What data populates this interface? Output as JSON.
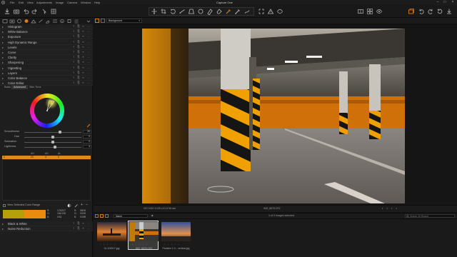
{
  "window": {
    "title": "Capture One",
    "menu": [
      "File",
      "Edit",
      "View",
      "Adjustments",
      "Image",
      "Camera",
      "Window",
      "Help"
    ],
    "controls": [
      "–",
      "□",
      "×"
    ]
  },
  "toolbar": {
    "left_icons": [
      "import-icon",
      "camera-icon",
      "undo-icon",
      "redo-icon",
      "cursor-icon",
      "grid-icon"
    ],
    "center_icons": [
      "pan-icon",
      "crop-icon",
      "rotate-icon",
      "straighten-icon",
      "keystone-icon",
      "spot-icon",
      "mask-icon",
      "erase-icon",
      "eyedropper-icon",
      "color-picker-icon",
      "annotate-icon"
    ],
    "right_icons": [
      "focus-icon",
      "exposure-warning-icon",
      "proof-icon",
      "compare-icon",
      "grid-view-icon",
      "eye-icon"
    ],
    "far_right_icons": [
      "workspace-icon",
      "rotate-left-icon",
      "rotate-right-icon",
      "reset-icon",
      "copy-icon",
      "paste-icon"
    ]
  },
  "tools": {
    "headers": [
      "Histogram",
      "White Balance",
      "Exposure",
      "High Dynamic Range",
      "Levels",
      "Curve",
      "Clarity",
      "Sharpening",
      "Vignetting",
      "Layers",
      "Color Balance",
      "Color Editor"
    ],
    "color_editor": {
      "tabs": [
        "Basic",
        "Advanced",
        "Skin Tone"
      ],
      "active_tab": "Advanced",
      "sliders": [
        {
          "label": "Smoothness",
          "value": "20",
          "pos": 0.62
        },
        {
          "label": "Hue",
          "value": "0",
          "pos": 0.5
        },
        {
          "label": "Saturation",
          "value": "0",
          "pos": 0.5
        },
        {
          "label": "Lightness",
          "value": "4",
          "pos": 0.54
        }
      ],
      "table": {
        "headers": [
          "Δ",
          "ΔH",
          "ΔS",
          "ΔL"
        ],
        "row": [
          "1",
          "20",
          "4",
          "0"
        ]
      },
      "view_selected_label": "View Selected Color Range",
      "info": {
        "rows": [
          {
            "k": "R:",
            "a": "176/227",
            "b": "58/00"
          },
          {
            "k": "G:",
            "a": "184/138",
            "b": "00/00"
          },
          {
            "k": "B:",
            "a": "0/52",
            "b": "0/399"
          }
        ]
      },
      "swatch_before": "#b5a00c",
      "swatch_after": "#e98b0c"
    },
    "footer_headers": [
      "Black & White",
      "Noise Reduction"
    ]
  },
  "viewer": {
    "preset": "Background",
    "footer_left": "ISO 1000  1/125 s  f/1.8  56 mm",
    "footer_center": "IMG_8678.CR2",
    "footer_right_icons": [
      "zoom-out-icon",
      "zoom-in-icon",
      "fit-icon",
      "fullscreen-icon"
    ]
  },
  "browser": {
    "sort": "Name",
    "status": "1 of 3 images selected",
    "search_placeholder": "Search Oil Record",
    "thumbnails": [
      {
        "name": "01-100017.jpg",
        "selected": false
      },
      {
        "name": "IMG_8678.CR2",
        "selected": true
      },
      {
        "name": "Parisien 1.0... vertical.jpg",
        "selected": false
      }
    ]
  },
  "colors": {
    "accent": "#e07a10",
    "highlight_bar": "#e08a1a",
    "background": "#141414",
    "panel": "#1e1e1e"
  }
}
